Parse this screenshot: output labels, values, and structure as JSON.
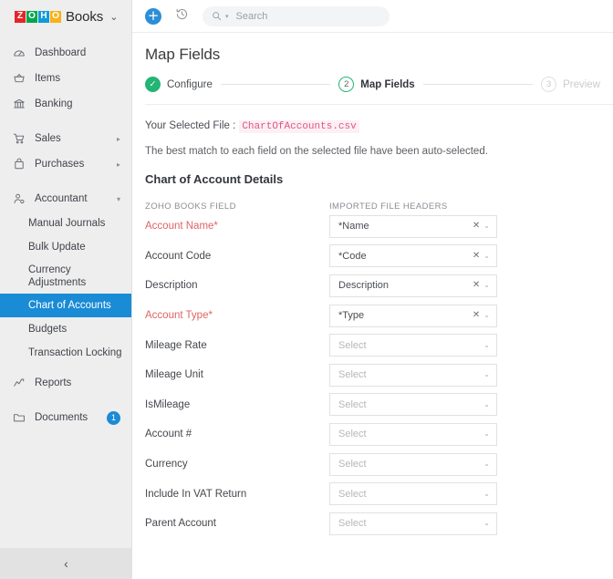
{
  "brand": {
    "logo_letters": [
      "Z",
      "O",
      "H",
      "O"
    ],
    "name": "Books",
    "caret": "⌄"
  },
  "sidebar": {
    "items": [
      {
        "label": "Dashboard",
        "icon": "gauge-icon",
        "arrow": ""
      },
      {
        "label": "Items",
        "icon": "basket-icon",
        "arrow": ""
      },
      {
        "label": "Banking",
        "icon": "bank-icon",
        "arrow": ""
      },
      {
        "label": "Sales",
        "icon": "cart-icon",
        "arrow": "▸"
      },
      {
        "label": "Purchases",
        "icon": "bag-icon",
        "arrow": "▸"
      },
      {
        "label": "Accountant",
        "icon": "accountant-icon",
        "arrow": "▾"
      }
    ],
    "accountant_subitems": [
      {
        "label": "Manual Journals",
        "active": false
      },
      {
        "label": "Bulk Update",
        "active": false
      },
      {
        "label": "Currency Adjustments",
        "active": false
      },
      {
        "label": "Chart of Accounts",
        "active": true
      },
      {
        "label": "Budgets",
        "active": false
      },
      {
        "label": "Transaction Locking",
        "active": false
      }
    ],
    "tail_items": [
      {
        "label": "Reports",
        "icon": "reports-icon",
        "badge": ""
      },
      {
        "label": "Documents",
        "icon": "folder-icon",
        "badge": "1"
      }
    ],
    "collapse_icon": "‹",
    "active_color": "#1a8bd5"
  },
  "topbar": {
    "add_icon": "+",
    "history_icon": "history-icon",
    "search": {
      "placeholder": "Search",
      "value": "",
      "icon": "search-icon",
      "caret": "▾"
    }
  },
  "page": {
    "title": "Map Fields"
  },
  "stepper": {
    "steps": [
      {
        "marker": "✓",
        "label": "Configure",
        "state": "done"
      },
      {
        "marker": "2",
        "label": "Map Fields",
        "state": "current"
      },
      {
        "marker": "3",
        "label": "Preview",
        "state": "todo"
      }
    ],
    "done_color": "#23b574"
  },
  "content": {
    "selected_file_label": "Your Selected File :",
    "selected_file_name": "ChartOfAccounts.csv",
    "hint": "The best match to each field on the selected file have been auto-selected.",
    "section_title": "Chart of Account Details",
    "col_header_left": "ZOHO BOOKS FIELD",
    "col_header_right": "IMPORTED FILE HEADERS",
    "select_placeholder": "Select",
    "clear_icon": "✕",
    "chevron_icon": "⌄",
    "rows": [
      {
        "field": "Account Name*",
        "required": true,
        "value": "*Name",
        "mapped": true
      },
      {
        "field": "Account Code",
        "required": false,
        "value": "*Code",
        "mapped": true
      },
      {
        "field": "Description",
        "required": false,
        "value": "Description",
        "mapped": true
      },
      {
        "field": "Account Type*",
        "required": true,
        "value": "*Type",
        "mapped": true
      },
      {
        "field": "Mileage Rate",
        "required": false,
        "value": "Select",
        "mapped": false
      },
      {
        "field": "Mileage Unit",
        "required": false,
        "value": "Select",
        "mapped": false
      },
      {
        "field": "IsMileage",
        "required": false,
        "value": "Select",
        "mapped": false
      },
      {
        "field": "Account #",
        "required": false,
        "value": "Select",
        "mapped": false
      },
      {
        "field": "Currency",
        "required": false,
        "value": "Select",
        "mapped": false
      },
      {
        "field": "Include In VAT Return",
        "required": false,
        "value": "Select",
        "mapped": false
      },
      {
        "field": "Parent Account",
        "required": false,
        "value": "Select",
        "mapped": false
      }
    ]
  }
}
